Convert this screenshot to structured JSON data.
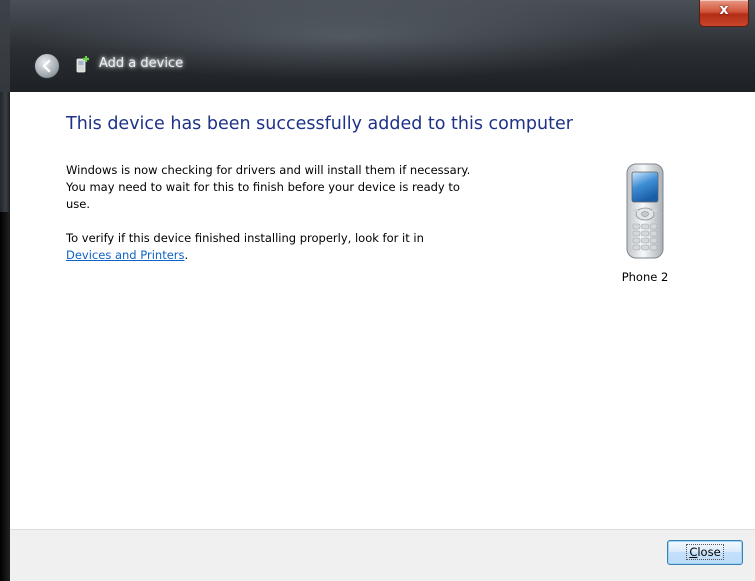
{
  "window": {
    "title": "Add a device",
    "close_glyph": "x"
  },
  "content": {
    "heading": "This device has been successfully added to this computer",
    "paragraph1": "Windows is now checking for drivers and will install them if necessary. You may need to wait for this to finish before your device is ready to use.",
    "paragraph2_text": "To verify if this device finished installing properly, look for it in",
    "paragraph2_link": "Devices and Printers",
    "paragraph2_end": "."
  },
  "device": {
    "name": "Phone 2",
    "icon": "mobile-phone-icon"
  },
  "footer": {
    "close_button_label": "Close",
    "close_button_accesskey": "C"
  },
  "colors": {
    "heading": "#1e3287",
    "link": "#0e63c6",
    "footer_bg": "#f0f0f0"
  }
}
